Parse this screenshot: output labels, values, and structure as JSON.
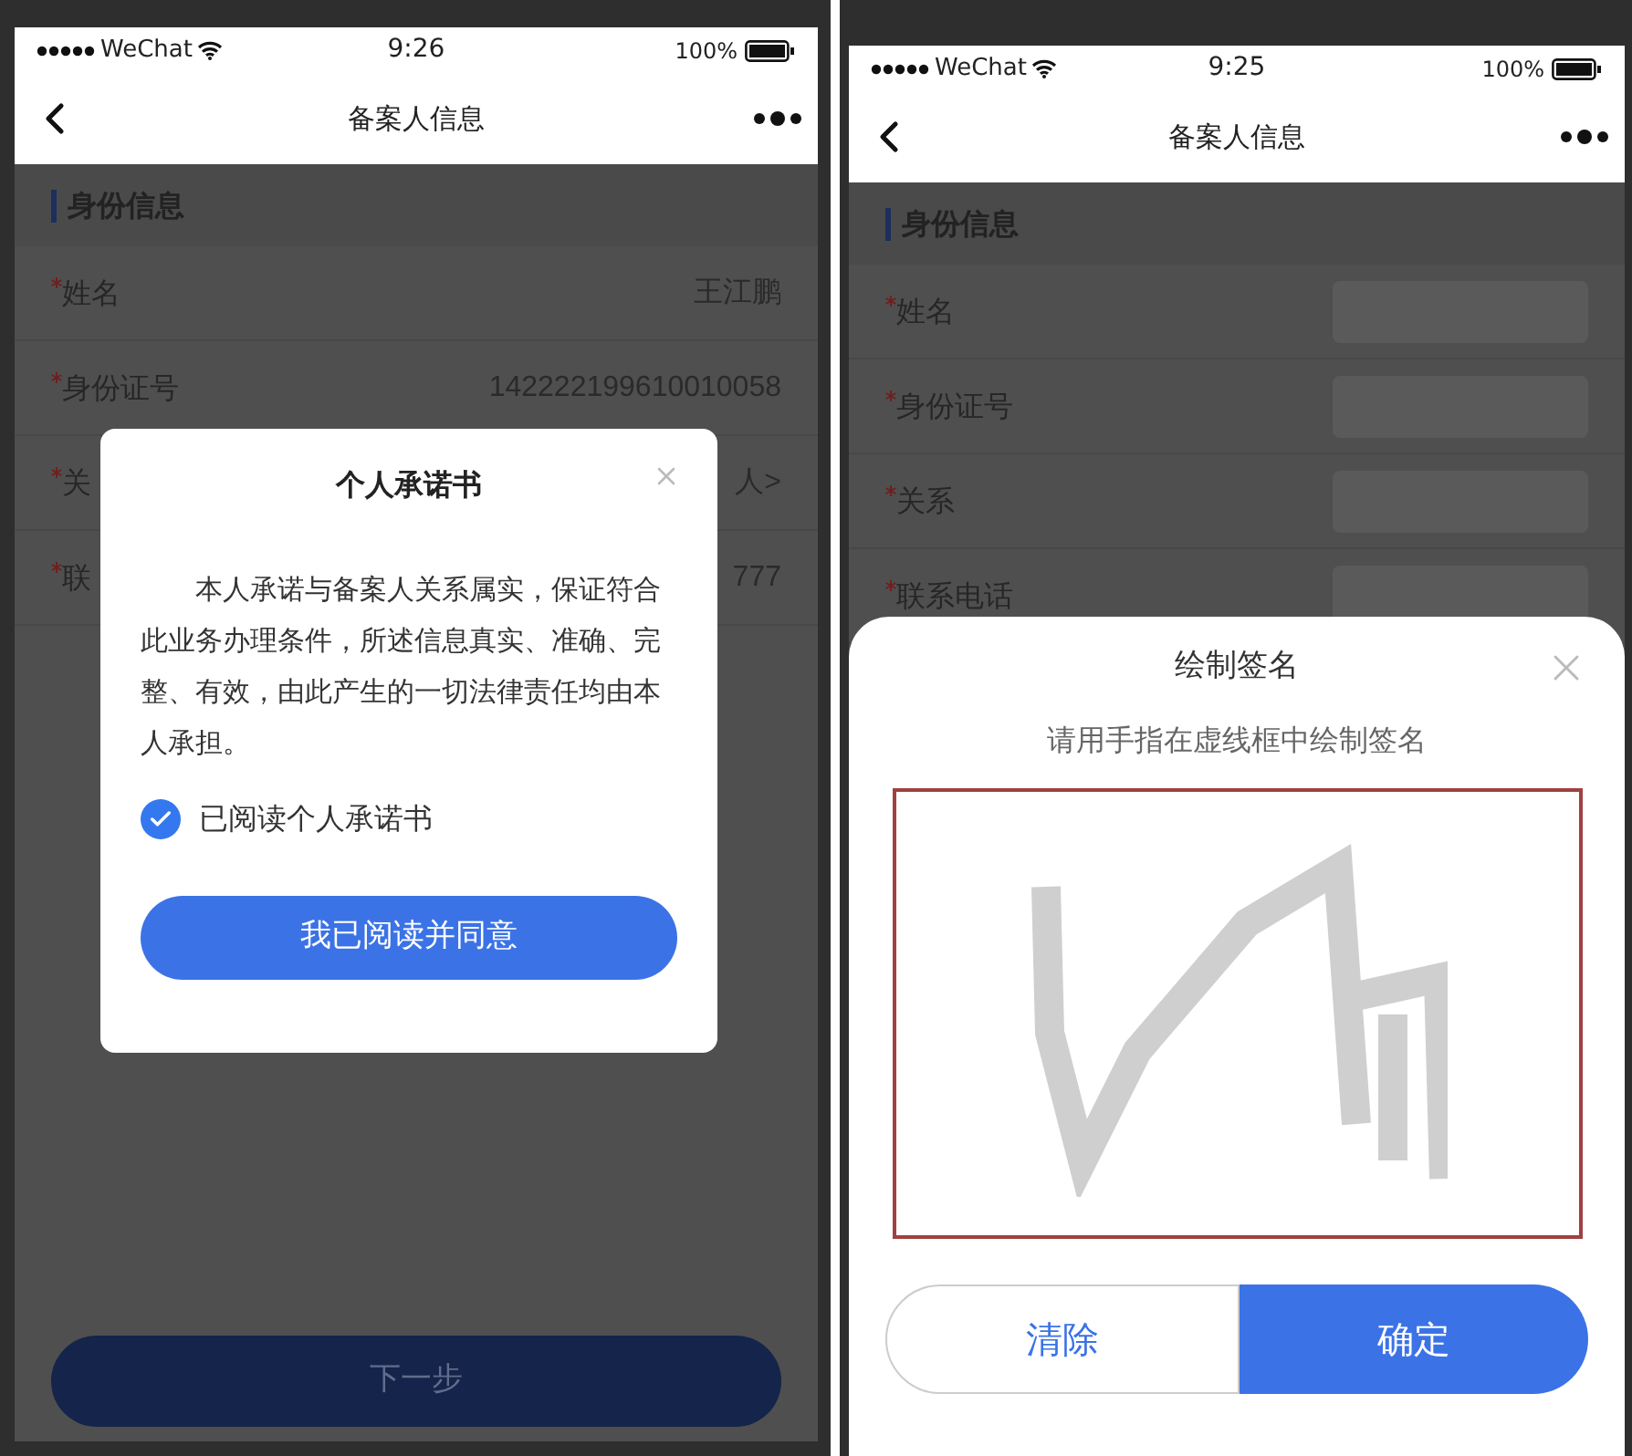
{
  "left_screen": {
    "status_bar": {
      "carrier": "WeChat",
      "time": "9:26",
      "battery": "100%"
    },
    "nav": {
      "title": "备案人信息"
    },
    "section_title": "身份信息",
    "rows": [
      {
        "label": "姓名",
        "required": true,
        "value": "王江鹏"
      },
      {
        "label": "身份证号",
        "required": true,
        "value": "142222199610010058"
      },
      {
        "label": "关",
        "required": true,
        "value": "人>"
      },
      {
        "label": "联",
        "required": true,
        "value": "777"
      }
    ],
    "next_button": "下一步",
    "dialog": {
      "title": "个人承诺书",
      "body": "本人承诺与备案人关系属实，保证符合此业务办理条件，所述信息真实、准确、完整、有效，由此产生的一切法律责任均由本人承担。",
      "checkbox": {
        "label": "已阅读个人承诺书",
        "checked": true
      },
      "agree_button": "我已阅读并同意"
    }
  },
  "right_screen": {
    "status_bar": {
      "carrier": "WeChat",
      "time": "9:25",
      "battery": "100%"
    },
    "nav": {
      "title": "备案人信息"
    },
    "section_title": "身份信息",
    "rows": [
      {
        "label": "姓名",
        "required": true,
        "blurred": true
      },
      {
        "label": "身份证号",
        "required": true,
        "blurred": true
      },
      {
        "label": "关系",
        "required": true,
        "blurred": true
      },
      {
        "label": "联系电话",
        "required": true,
        "blurred": true
      }
    ],
    "sheet": {
      "title": "绘制签名",
      "hint": "请用手指在虚线框中绘制签名",
      "buttons": [
        {
          "label": "清除",
          "kind": "outline"
        },
        {
          "label": "确定",
          "kind": "primary"
        }
      ]
    }
  }
}
